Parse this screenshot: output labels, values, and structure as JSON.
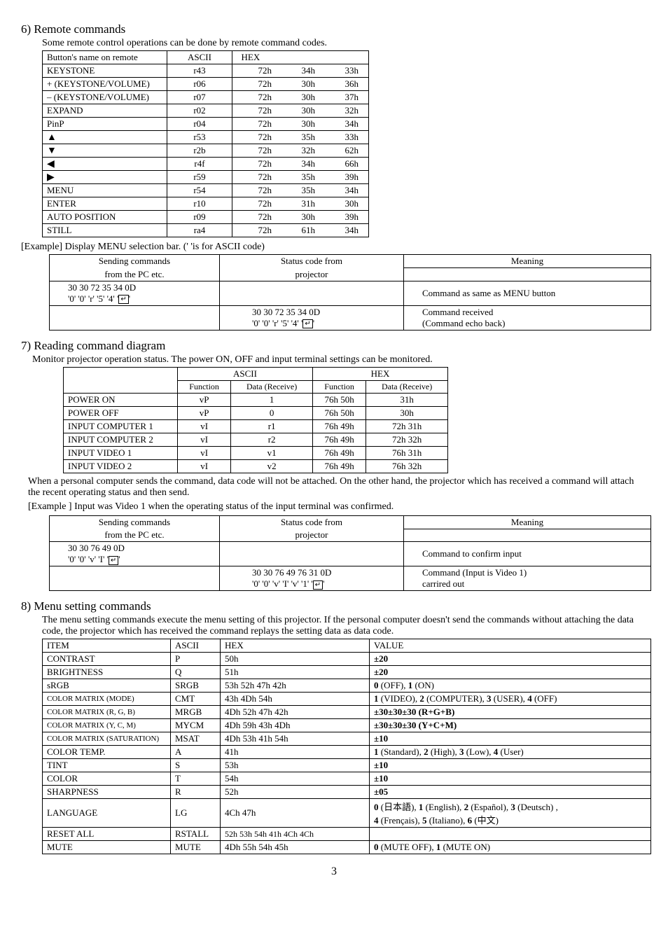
{
  "section6": {
    "title": "6) Remote commands",
    "intro": "Some remote control operations can be done by remote command codes.",
    "table": {
      "headers": [
        "Button's name on remote",
        "ASCII",
        "HEX"
      ],
      "rows": [
        {
          "name": "KEYSTONE",
          "ascii": "r43",
          "hex": [
            "72h",
            "34h",
            "33h"
          ]
        },
        {
          "name": "+ (KEYSTONE/VOLUME)",
          "ascii": "r06",
          "hex": [
            "72h",
            "30h",
            "36h"
          ]
        },
        {
          "name": "– (KEYSTONE/VOLUME)",
          "ascii": "r07",
          "hex": [
            "72h",
            "30h",
            "37h"
          ]
        },
        {
          "name": "EXPAND",
          "ascii": "r02",
          "hex": [
            "72h",
            "30h",
            "32h"
          ]
        },
        {
          "name": "PinP",
          "ascii": "r04",
          "hex": [
            "72h",
            "30h",
            "34h"
          ]
        },
        {
          "name": "▲",
          "ascii": "r53",
          "hex": [
            "72h",
            "35h",
            "33h"
          ],
          "isArrow": true
        },
        {
          "name": "▼",
          "ascii": "r2b",
          "hex": [
            "72h",
            "32h",
            "62h"
          ],
          "isArrow": true
        },
        {
          "name": "◀",
          "ascii": "r4f",
          "hex": [
            "72h",
            "34h",
            "66h"
          ],
          "isArrow": true
        },
        {
          "name": "▶",
          "ascii": "r59",
          "hex": [
            "72h",
            "35h",
            "39h"
          ],
          "isArrow": true
        },
        {
          "name": "MENU",
          "ascii": "r54",
          "hex": [
            "72h",
            "35h",
            "34h"
          ]
        },
        {
          "name": "ENTER",
          "ascii": "r10",
          "hex": [
            "72h",
            "31h",
            "30h"
          ]
        },
        {
          "name": "AUTO POSITION",
          "ascii": "r09",
          "hex": [
            "72h",
            "30h",
            "39h"
          ]
        },
        {
          "name": "STILL",
          "ascii": "ra4",
          "hex": [
            "72h",
            "61h",
            "34h"
          ]
        }
      ]
    },
    "example": {
      "label": "[Example] Display MENU selection bar. ('  'is for ASCII code)",
      "headers": [
        "Sending commands",
        "Status code from",
        "Meaning"
      ],
      "subheaders": [
        "from the PC etc.",
        "projector",
        ""
      ],
      "rows": [
        {
          "send": "30 30 72 35 34 0D",
          "sendPlain": "'0' '0' 'r' '5' '4' '",
          "status": "",
          "meaning": "Command as same as MENU button"
        },
        {
          "send": "",
          "status": "30 30 72 35 34 0D",
          "statusPlain": "'0' '0' 'r' '5' '4' '",
          "meaning": "Command received",
          "meaning2": "(Command echo back)"
        }
      ]
    }
  },
  "section7": {
    "title": "7) Reading command diagram",
    "intro": "Monitor projector operation status. The power ON, OFF and input terminal settings can be monitored.",
    "table": {
      "group1": "ASCII",
      "group2": "HEX",
      "sub": [
        "Function",
        "Data (Receive)",
        "Function",
        "Data (Receive)"
      ],
      "rows": [
        {
          "name": "POWER ON",
          "c": [
            "vP",
            "1",
            "76h 50h",
            "31h"
          ]
        },
        {
          "name": "POWER OFF",
          "c": [
            "vP",
            "0",
            "76h 50h",
            "30h"
          ]
        },
        {
          "name": "INPUT COMPUTER 1",
          "c": [
            "vI",
            "r1",
            "76h 49h",
            "72h 31h"
          ]
        },
        {
          "name": "INPUT COMPUTER 2",
          "c": [
            "vI",
            "r2",
            "76h 49h",
            "72h 32h"
          ]
        },
        {
          "name": "INPUT VIDEO 1",
          "c": [
            "vI",
            "v1",
            "76h 49h",
            "76h 31h"
          ]
        },
        {
          "name": "INPUT VIDEO 2",
          "c": [
            "vI",
            "v2",
            "76h 49h",
            "76h 32h"
          ]
        }
      ]
    },
    "note": "When a personal computer sends the command, data code will not be attached. On the other hand, the projector which has received a command will attach the recent operating status and then send.",
    "exampleLabel": "[Example ]  Input  was Video 1 when the operating status of the input terminal was confirmed.",
    "exTable": {
      "headers": [
        "Sending commands",
        "Status code from",
        "Meaning"
      ],
      "subheaders": [
        "from the PC etc.",
        "projector",
        ""
      ],
      "rows": [
        {
          "send": "30 30 76 49 0D",
          "sendPlain": "'0' '0' 'v' 'I' '",
          "status": "",
          "meaning": "Command to confirm input"
        },
        {
          "send": "",
          "status": "30 30 76 49 76 31 0D",
          "statusPlain": "'0' '0' 'v' 'I' 'v' '1' '",
          "meaning": "Command (Input is Video 1)",
          "meaning2": "carrired out"
        }
      ]
    }
  },
  "section8": {
    "title": "8) Menu setting commands",
    "intro": "The menu setting commands execute the menu setting of this projector. If the personal computer doesn't send the commands without attaching the data code, the projector which has received the command replays the setting data as data code.",
    "table": {
      "headers": [
        "ITEM",
        "ASCII",
        "HEX",
        "VALUE"
      ],
      "rows": [
        {
          "item": "CONTRAST",
          "ascii": "P",
          "hex": "50h",
          "value": "±20",
          "bold": true
        },
        {
          "item": "BRIGHTNESS",
          "ascii": "Q",
          "hex": "51h",
          "value": "±20",
          "bold": true
        },
        {
          "item": "sRGB",
          "ascii": "SRGB",
          "hex": "53h    52h    47h    42h",
          "value": "0 (OFF), 1 (ON)",
          "boldNums": true
        },
        {
          "item": "COLOR MATRIX (MODE)",
          "ascii": "CMT",
          "hex": "43h    4Dh    54h",
          "value": "1 (VIDEO), 2 (COMPUTER), 3 (USER), 4 (OFF)",
          "boldNums": true,
          "small": true
        },
        {
          "item": "COLOR MATRIX (R, G, B)",
          "ascii": "MRGB",
          "hex": "4Dh    52h    47h    42h",
          "value": "±30±30±30  (R+G+B)",
          "bold": true,
          "small": true
        },
        {
          "item": "COLOR MATRIX (Y, C, M)",
          "ascii": "MYCM",
          "hex": "4Dh    59h    43h    4Dh",
          "value": "±30±30±30  (Y+C+M)",
          "bold": true,
          "small": true
        },
        {
          "item": "COLOR MATRIX (SATURATION)",
          "ascii": "MSAT",
          "hex": "4Dh    53h    41h    54h",
          "value": "±10",
          "bold": true,
          "small": true
        },
        {
          "item": "COLOR TEMP.",
          "ascii": "A",
          "hex": "41h",
          "value": "1 (Standard), 2 (High), 3 (Low), 4 (User)",
          "boldNums": true
        },
        {
          "item": "TINT",
          "ascii": "S",
          "hex": "53h",
          "value": "±10",
          "bold": true
        },
        {
          "item": "COLOR",
          "ascii": "T",
          "hex": "54h",
          "value": "±10",
          "bold": true
        },
        {
          "item": "SHARPNESS",
          "ascii": "R",
          "hex": "52h",
          "value": "±05",
          "bold": true
        },
        {
          "item": "LANGUAGE",
          "ascii": "LG",
          "hex": "4Ch    47h",
          "value": "0 (日本語), 1 (English), 2 (Español), 3 (Deutsch) ,",
          "value2": "4 (Frençais),  5 (Italiano), 6 (中文)",
          "boldNums": true
        },
        {
          "item": "RESET ALL",
          "ascii": "RSTALL",
          "hex": "52h  53h   54h   41h   4Ch  4Ch",
          "value": "",
          "smallhex": true
        },
        {
          "item": "MUTE",
          "ascii": "MUTE",
          "hex": "4Dh    55h    54h    45h",
          "value": "0 (MUTE OFF), 1 (MUTE ON)",
          "boldNums": true
        }
      ]
    }
  },
  "pageNumber": "3"
}
